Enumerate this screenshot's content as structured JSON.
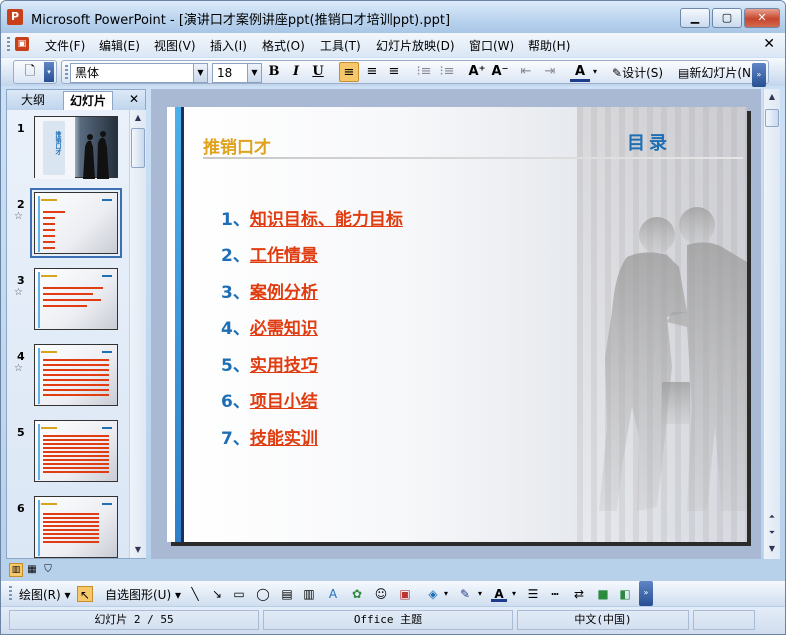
{
  "window": {
    "title": "Microsoft PowerPoint - [演讲口才案例讲座ppt(推销口才培训ppt).ppt]",
    "app_icon": "P",
    "minimize": "▁",
    "restore": "▢",
    "close": "✕"
  },
  "menu": {
    "items": [
      "文件(F)",
      "编辑(E)",
      "视图(V)",
      "插入(I)",
      "格式(O)",
      "工具(T)",
      "幻灯片放映(D)",
      "窗口(W)",
      "帮助(H)"
    ],
    "close": "✕"
  },
  "toolbar": {
    "font_name": "黑体",
    "font_size": "18",
    "bold": "B",
    "italic": "I",
    "underline": "U",
    "design_label": "设计(S)",
    "new_slide_label": "新幻灯片(N)",
    "font_color_label": "A"
  },
  "left_pane": {
    "tab_outline": "大纲",
    "tab_slides": "幻灯片",
    "close": "✕",
    "slide_numbers": [
      "1",
      "2",
      "3",
      "4",
      "5",
      "6"
    ],
    "star": "☆"
  },
  "slide": {
    "brand": "推销口才",
    "title": "目录",
    "items": [
      {
        "num": "1、",
        "text": "知识目标、能力目标"
      },
      {
        "num": "2、",
        "text": "工作情景"
      },
      {
        "num": "3、",
        "text": "案例分析"
      },
      {
        "num": "4、",
        "text": "必需知识"
      },
      {
        "num": "5、",
        "text": "实用技巧"
      },
      {
        "num": "6、",
        "text": "项目小结"
      },
      {
        "num": "7、",
        "text": "技能实训"
      }
    ],
    "thumb1_text": "推销口才"
  },
  "drawing_toolbar": {
    "draw_label": "绘图(R)",
    "autoshape_label": "自选图形(U)"
  },
  "status": {
    "slide_pos": "幻灯片 2 / 55",
    "theme": "Office 主题",
    "language": "中文(中国)"
  },
  "colors": {
    "accent_blue": "#1e6eb5",
    "link_red": "#e03c10",
    "brand_gold": "#e0a21c"
  }
}
